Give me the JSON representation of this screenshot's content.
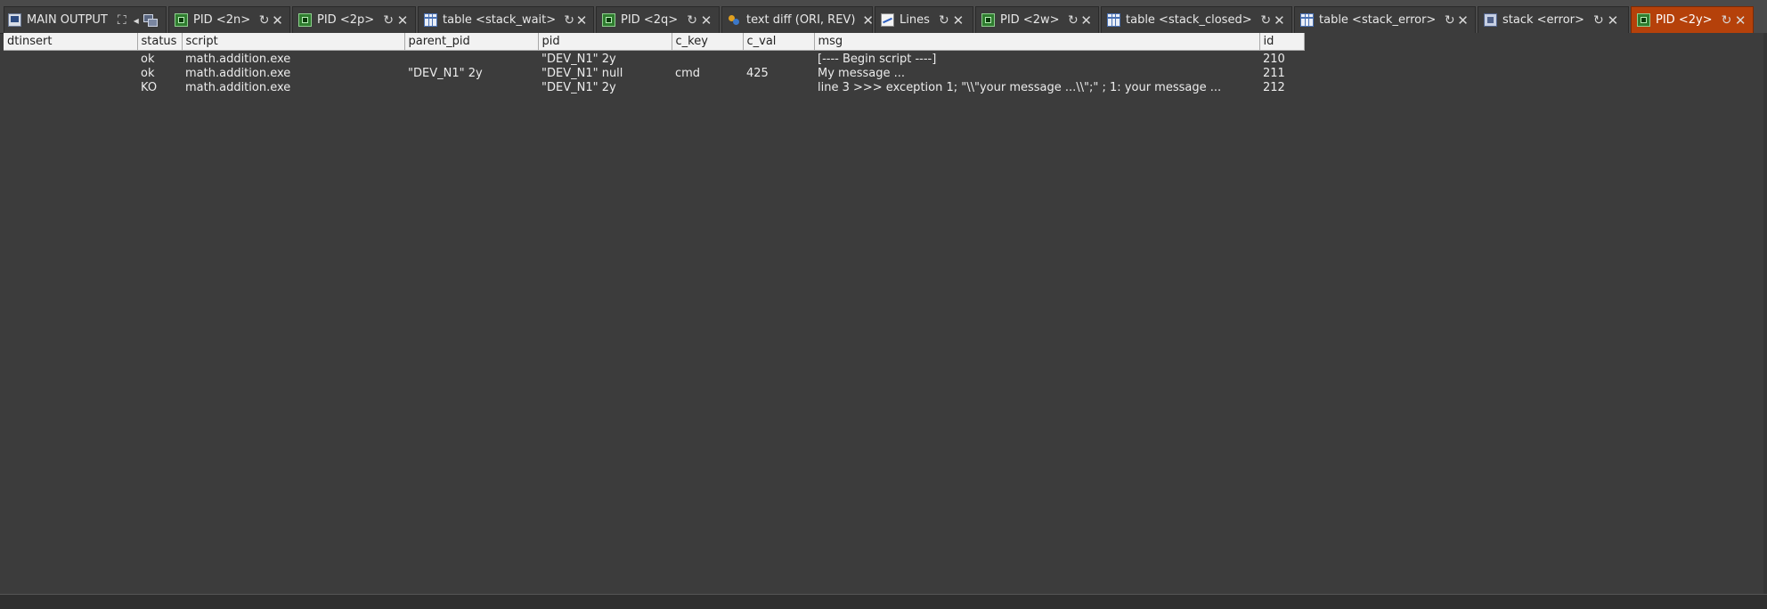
{
  "tabs": [
    {
      "key": "main",
      "label": "MAIN OUTPUT",
      "icon": "output-window-icon",
      "active": false
    },
    {
      "key": "pid-2n",
      "label": "PID <2n>",
      "icon": "process-chip-icon",
      "active": false
    },
    {
      "key": "pid-2p",
      "label": "PID <2p>",
      "icon": "process-chip-icon",
      "active": false
    },
    {
      "key": "stack-wait",
      "label": "table <stack_wait>",
      "icon": "table-grid-icon",
      "active": false
    },
    {
      "key": "pid-2q",
      "label": "PID <2q>",
      "icon": "process-chip-icon",
      "active": false
    },
    {
      "key": "text-diff",
      "label": "text diff (ORI, REV)",
      "icon": "text-diff-icon",
      "active": false
    },
    {
      "key": "lines",
      "label": "Lines",
      "icon": "line-chart-icon",
      "active": false
    },
    {
      "key": "pid-2w",
      "label": "PID <2w>",
      "icon": "process-chip-icon",
      "active": false
    },
    {
      "key": "stack-closed",
      "label": "table <stack_closed>",
      "icon": "table-grid-icon",
      "active": false
    },
    {
      "key": "stack-error-table",
      "label": "table <stack_error>",
      "icon": "table-grid-icon",
      "active": false
    },
    {
      "key": "stack-error",
      "label": "stack <error>",
      "icon": "stack-window-icon",
      "active": false
    },
    {
      "key": "pid-2y",
      "label": "PID <2y>",
      "icon": "process-chip-icon",
      "active": true
    }
  ],
  "colors": {
    "background": "#3c3c3c",
    "tabbar": "#4a4a4a",
    "active_tab": "#b5410a",
    "header_bg": "#f2f2f2"
  },
  "table": {
    "columns": [
      "dtinsert",
      "status",
      "script",
      "parent_pid",
      "pid",
      "c_key",
      "c_val",
      "msg",
      "id"
    ],
    "rows": [
      {
        "dtinsert": "",
        "status": "ok",
        "script": "math.addition.exe",
        "parent_pid": "",
        "pid": "\"DEV_N1\" 2y",
        "c_key": "",
        "c_val": "",
        "msg": "[---- Begin script ----]",
        "id": "210"
      },
      {
        "dtinsert": "",
        "status": "ok",
        "script": "math.addition.exe",
        "parent_pid": "\"DEV_N1\" 2y",
        "pid": "\"DEV_N1\" null",
        "c_key": "cmd",
        "c_val": "425",
        "msg": "My message ...",
        "id": "211"
      },
      {
        "dtinsert": "",
        "status": "KO",
        "script": "math.addition.exe",
        "parent_pid": "",
        "pid": "\"DEV_N1\" 2y",
        "c_key": "",
        "c_val": "",
        "msg": "line 3 >>> exception 1; \"\\\\\"your message ...\\\\\";\" ; 1: your message ...",
        "id": "212"
      }
    ]
  }
}
